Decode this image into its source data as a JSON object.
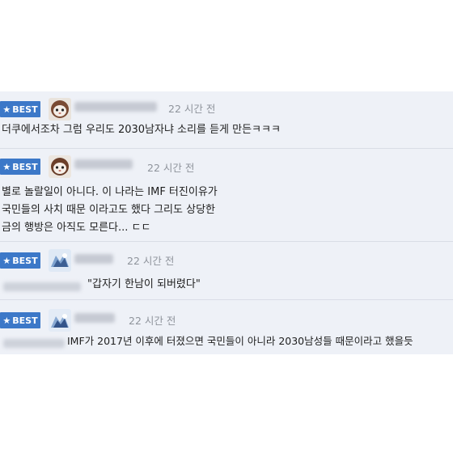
{
  "comments": [
    {
      "badge": "BEST",
      "time": "22 시간 전",
      "lines": [
        "더쿠에서조차 그럼 우리도 2030남자냐 소리를 듣게 만든ㅋㅋㅋ"
      ]
    },
    {
      "badge": "BEST",
      "time": "22 시간 전",
      "lines": [
        "별로 놀랄일이 아니다. 이 나라는 IMF 터진이유가",
        "국민들의 사치 때문 이라고도 했다 그리도 상당한",
        "금의 행방은 아직도 모른다... ㄷㄷ"
      ]
    },
    {
      "badge": "BEST",
      "time": "22 시간 전",
      "lines": [
        "\"갑자기 한남이 되버렸다\""
      ]
    },
    {
      "badge": "BEST",
      "time": "22 시간 전",
      "lines": [
        "IMF가 2017년 이후에 터졌으면 국민들이 아니라 2030남성들 때문이라고 했을듯"
      ]
    }
  ],
  "colors": {
    "badge_bg": "#3c78c8",
    "panel_bg": "#eef1f7",
    "time_text": "#8f949c"
  },
  "icons": {
    "badge_icon": "star-icon",
    "avatar_icon": "avatar-icon"
  }
}
